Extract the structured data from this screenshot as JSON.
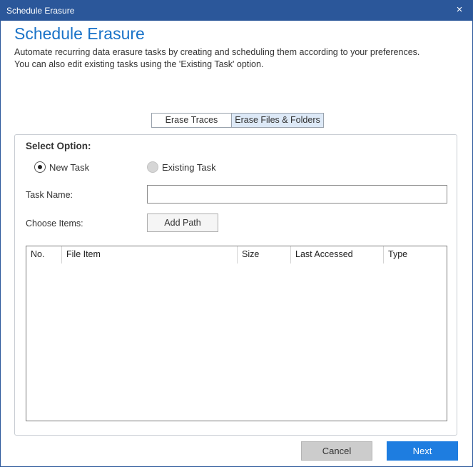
{
  "window": {
    "title": "Schedule Erasure",
    "close_icon": "×"
  },
  "header": {
    "title": "Schedule Erasure",
    "description_line1": "Automate recurring data erasure tasks by creating and scheduling them according to your preferences.",
    "description_line2": "You can also edit existing tasks using the 'Existing Task' option."
  },
  "tabs": [
    {
      "label": "Erase Traces",
      "active": false
    },
    {
      "label": "Erase Files & Folders",
      "active": true
    }
  ],
  "form": {
    "select_option_label": "Select Option:",
    "options": [
      {
        "label": "New Task",
        "checked": true,
        "enabled": true
      },
      {
        "label": "Existing Task",
        "checked": false,
        "enabled": false
      }
    ],
    "task_name_label": "Task Name:",
    "task_name_value": "",
    "choose_items_label": "Choose Items:",
    "add_path_label": "Add Path"
  },
  "table": {
    "columns": [
      "No.",
      "File Item",
      "Size",
      "Last Accessed",
      "Type"
    ],
    "rows": []
  },
  "footer": {
    "cancel_label": "Cancel",
    "next_label": "Next"
  },
  "colors": {
    "titlebar": "#2b579a",
    "heading": "#1a73c8",
    "primary_button": "#1e7de0",
    "active_tab": "#dde9f7"
  }
}
